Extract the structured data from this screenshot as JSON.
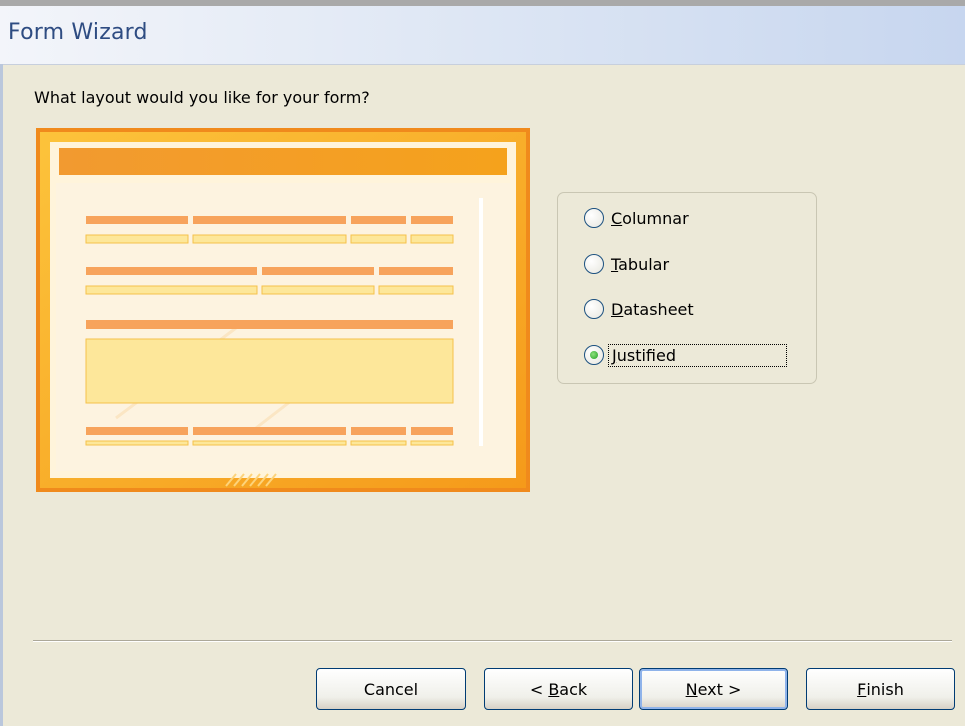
{
  "window": {
    "title": "Form Wizard"
  },
  "prompt": "What layout would you like for your form?",
  "layout_options": [
    {
      "label": "Columnar",
      "mnemonic": "C",
      "selected": false
    },
    {
      "label": "Tabular",
      "mnemonic": "T",
      "selected": false
    },
    {
      "label": "Datasheet",
      "mnemonic": "D",
      "selected": false
    },
    {
      "label": "Justified",
      "mnemonic": "J",
      "selected": true
    }
  ],
  "buttons": {
    "cancel": {
      "label": "Cancel"
    },
    "back": {
      "pre": "< ",
      "mn": "B",
      "post": "ack"
    },
    "next": {
      "pre": "",
      "mn": "N",
      "post": "ext >"
    },
    "finish": {
      "pre": "",
      "mn": "F",
      "post": "inish"
    }
  },
  "colors": {
    "title_text": "#2e4c82",
    "preview_frame": "#f7a21b",
    "preview_header": "#f39a1f",
    "preview_label": "#f7a35c",
    "preview_field": "#fde79a",
    "radio_selected": "#21a121"
  },
  "icons": {
    "preview": "justified-layout-preview"
  }
}
